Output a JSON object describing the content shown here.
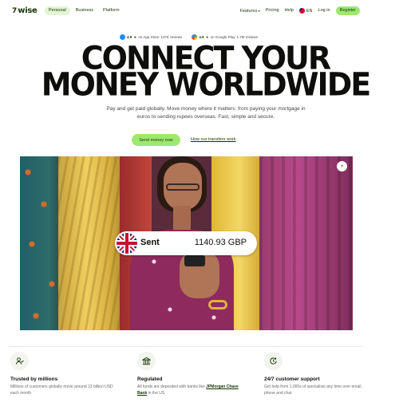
{
  "nav": {
    "logo_mark": "7",
    "logo_text": "wise",
    "left_items": [
      "Personal",
      "Business",
      "Platform"
    ],
    "features": "Features",
    "features_chevron": "▾",
    "pricing": "Pricing",
    "help": "Help",
    "language": "EN",
    "login": "Log in",
    "register": "Register"
  },
  "ratings": {
    "appstore_score": "4.9",
    "appstore_text": "on App Store",
    "appstore_count": "147K reviews",
    "gplay_score": "4.9",
    "gplay_text": "on Google Play",
    "gplay_count": "1.7M reviews",
    "star": "★"
  },
  "hero": {
    "headline_line1": "CONNECT YOUR",
    "headline_line2": "MONEY WORLDWIDE",
    "subcopy": "Pay and get paid globally. Move money where it matters: from paying your mortgage in euros to sending rupees overseas. Fast, simple and secure.",
    "cta_primary": "Send money now",
    "cta_link": "How our transfers work",
    "close_symbol": "×",
    "sent_label": "Sent",
    "sent_amount": "1140.93 GBP"
  },
  "features": [
    {
      "title": "Trusted by millions",
      "desc": "Millions of customers globally move around 13 billion USD each month"
    },
    {
      "title": "Regulated",
      "desc_pre": "All funds are deposited with banks like ",
      "desc_link": "JPMorgan Chase Bank",
      "desc_post": " in the US"
    },
    {
      "title": "24/7 customer support",
      "desc": "Get help from 1,000s of specialists any time over email, phone and chat"
    }
  ],
  "colors": {
    "brand_green": "#9fe870",
    "forest": "#163300",
    "pill_bg": "#e2f6d5"
  }
}
